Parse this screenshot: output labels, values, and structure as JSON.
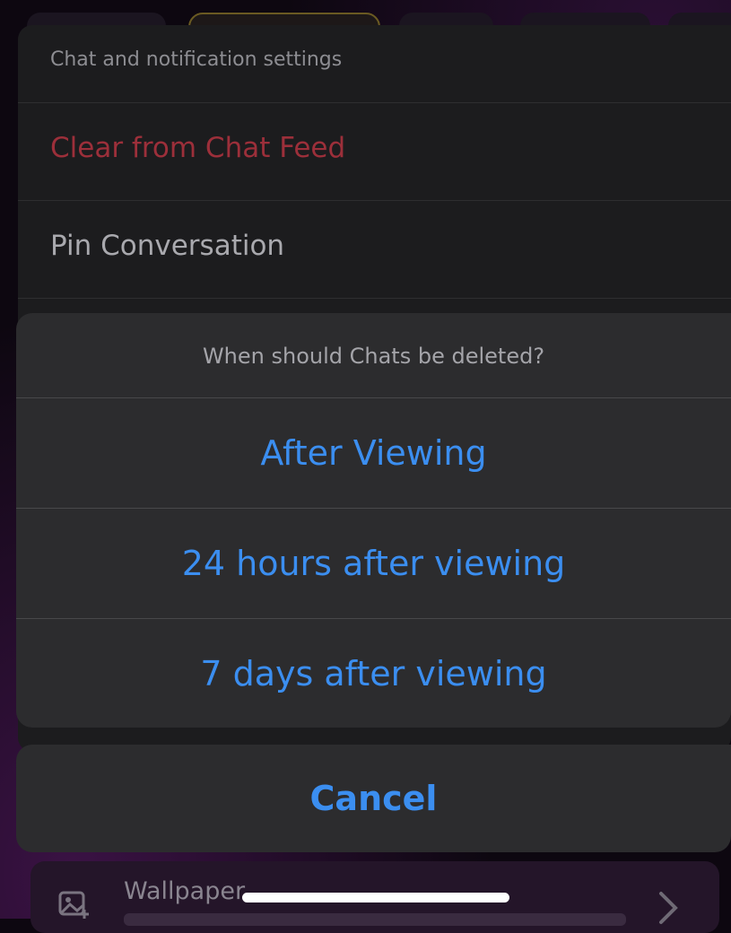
{
  "background_sheet": {
    "header": "Chat and notification settings",
    "clear_label": "Clear from Chat Feed",
    "pin_label": "Pin Conversation"
  },
  "action_sheet": {
    "title": "When should Chats be deleted?",
    "options": [
      {
        "label": "After Viewing"
      },
      {
        "label": "24 hours after viewing"
      },
      {
        "label": "7 days after viewing"
      }
    ],
    "cancel_label": "Cancel"
  },
  "wallpaper": {
    "label": "Wallpaper",
    "icon": "image-icon",
    "chevron": "chevron-right-icon"
  },
  "colors": {
    "accent": "#3b8ef0",
    "destructive": "#9c2f3a",
    "sheet": "#2c2c2e"
  }
}
